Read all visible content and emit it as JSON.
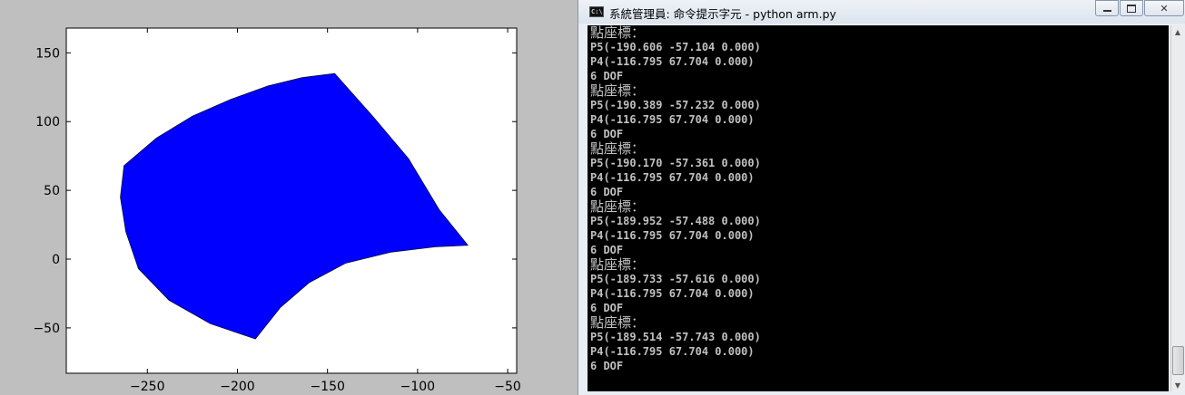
{
  "chart_data": {
    "type": "area",
    "description_shape": "filled workspace region (annular sector)",
    "fill_color": "#0000ff",
    "xlim": [
      -295,
      -45
    ],
    "ylim": [
      -83,
      168
    ],
    "x_ticks": [
      -250,
      -200,
      -150,
      -100,
      -50
    ],
    "y_ticks": [
      -50,
      0,
      50,
      100,
      150
    ],
    "x_tick_labels": [
      "−250",
      "−200",
      "−150",
      "−100",
      "−50"
    ],
    "y_tick_labels": [
      "−50",
      "0",
      "50",
      "100",
      "150"
    ],
    "outline": [
      [
        -263,
        68
      ],
      [
        -245,
        88
      ],
      [
        -225,
        104
      ],
      [
        -204,
        116
      ],
      [
        -183,
        126
      ],
      [
        -164,
        132
      ],
      [
        -146,
        135
      ],
      [
        -125,
        104
      ],
      [
        -105,
        73
      ],
      [
        -88,
        36
      ],
      [
        -72,
        10
      ],
      [
        -90,
        9
      ],
      [
        -115,
        5
      ],
      [
        -140,
        -3
      ],
      [
        -160,
        -17
      ],
      [
        -176,
        -35
      ],
      [
        -190,
        -58
      ],
      [
        -215,
        -47
      ],
      [
        -238,
        -30
      ],
      [
        -255,
        -7
      ],
      [
        -262,
        20
      ],
      [
        -265,
        45
      ],
      [
        -263,
        68
      ]
    ]
  },
  "console": {
    "title": "系統管理員: 命令提示字元 - python  arm.py",
    "icon": "cmd-icon",
    "min_label": "minimize",
    "max_label": "maximize",
    "close_label": "close",
    "lines": [
      {
        "text": "點座標：",
        "cjk": true
      },
      {
        "text": "P5(-190.606 -57.104 0.000)",
        "cjk": false
      },
      {
        "text": "P4(-116.795 67.704 0.000)",
        "cjk": false
      },
      {
        "text": "6 DOF",
        "cjk": false
      },
      {
        "text": "點座標：",
        "cjk": true
      },
      {
        "text": "P5(-190.389 -57.232 0.000)",
        "cjk": false
      },
      {
        "text": "P4(-116.795 67.704 0.000)",
        "cjk": false
      },
      {
        "text": "6 DOF",
        "cjk": false
      },
      {
        "text": "點座標：",
        "cjk": true
      },
      {
        "text": "P5(-190.170 -57.361 0.000)",
        "cjk": false
      },
      {
        "text": "P4(-116.795 67.704 0.000)",
        "cjk": false
      },
      {
        "text": "6 DOF",
        "cjk": false
      },
      {
        "text": "點座標：",
        "cjk": true
      },
      {
        "text": "P5(-189.952 -57.488 0.000)",
        "cjk": false
      },
      {
        "text": "P4(-116.795 67.704 0.000)",
        "cjk": false
      },
      {
        "text": "6 DOF",
        "cjk": false
      },
      {
        "text": "點座標：",
        "cjk": true
      },
      {
        "text": "P5(-189.733 -57.616 0.000)",
        "cjk": false
      },
      {
        "text": "P4(-116.795 67.704 0.000)",
        "cjk": false
      },
      {
        "text": "6 DOF",
        "cjk": false
      },
      {
        "text": "點座標：",
        "cjk": true
      },
      {
        "text": "P5(-189.514 -57.743 0.000)",
        "cjk": false
      },
      {
        "text": "P4(-116.795 67.704 0.000)",
        "cjk": false
      },
      {
        "text": "6 DOF",
        "cjk": false
      }
    ]
  }
}
